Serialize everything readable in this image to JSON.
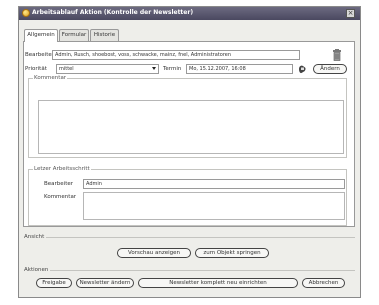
{
  "window": {
    "title": "Arbeitsablauf Aktion (Kontrolle der Newsletter)",
    "close_glyph": "×"
  },
  "tabs": [
    {
      "label": "Allgemein",
      "active": true
    },
    {
      "label": "Formular",
      "active": false
    },
    {
      "label": "Historie",
      "active": false
    }
  ],
  "form": {
    "bearbeiter_label": "Bearbeiter",
    "bearbeiter_value": "Admin, Rusch, shoebost, voss, schwacke, mainz, fnel, Administratoren",
    "prioritaet_label": "Priorität",
    "prioritaet_value": "mittel",
    "termin_label": "Termin",
    "termin_value": "Mo, 15.12.2007, 16:08",
    "aendern_label": "Ändern",
    "kommentar_legend": "Kommentar",
    "kommentar_value": ""
  },
  "last_step": {
    "legend": "Letzer Arbeitsschritt",
    "bearbeiter_label": "Bearbeiter",
    "bearbeiter_value": "Admin",
    "kommentar_label": "Kommentar",
    "kommentar_value": ""
  },
  "ansicht": {
    "legend": "Ansicht",
    "preview_label": "Vorschau anzeigen",
    "goto_label": "zum Objekt springen"
  },
  "aktionen": {
    "legend": "Aktionen",
    "freigabe_label": "Freigabe",
    "newsletter_aendern_label": "Newsletter ändern",
    "newsletter_neu_label": "Newsletter komplett neu einrichten",
    "abbrechen_label": "Abbrechen"
  },
  "icons": {
    "app": "app-icon",
    "trash": "trash-icon",
    "calendar": "calendar-icon"
  },
  "colors": {
    "titlebar": "#5a586e",
    "window_bg": "#eeeeea",
    "panel_bg": "#ffffff"
  }
}
